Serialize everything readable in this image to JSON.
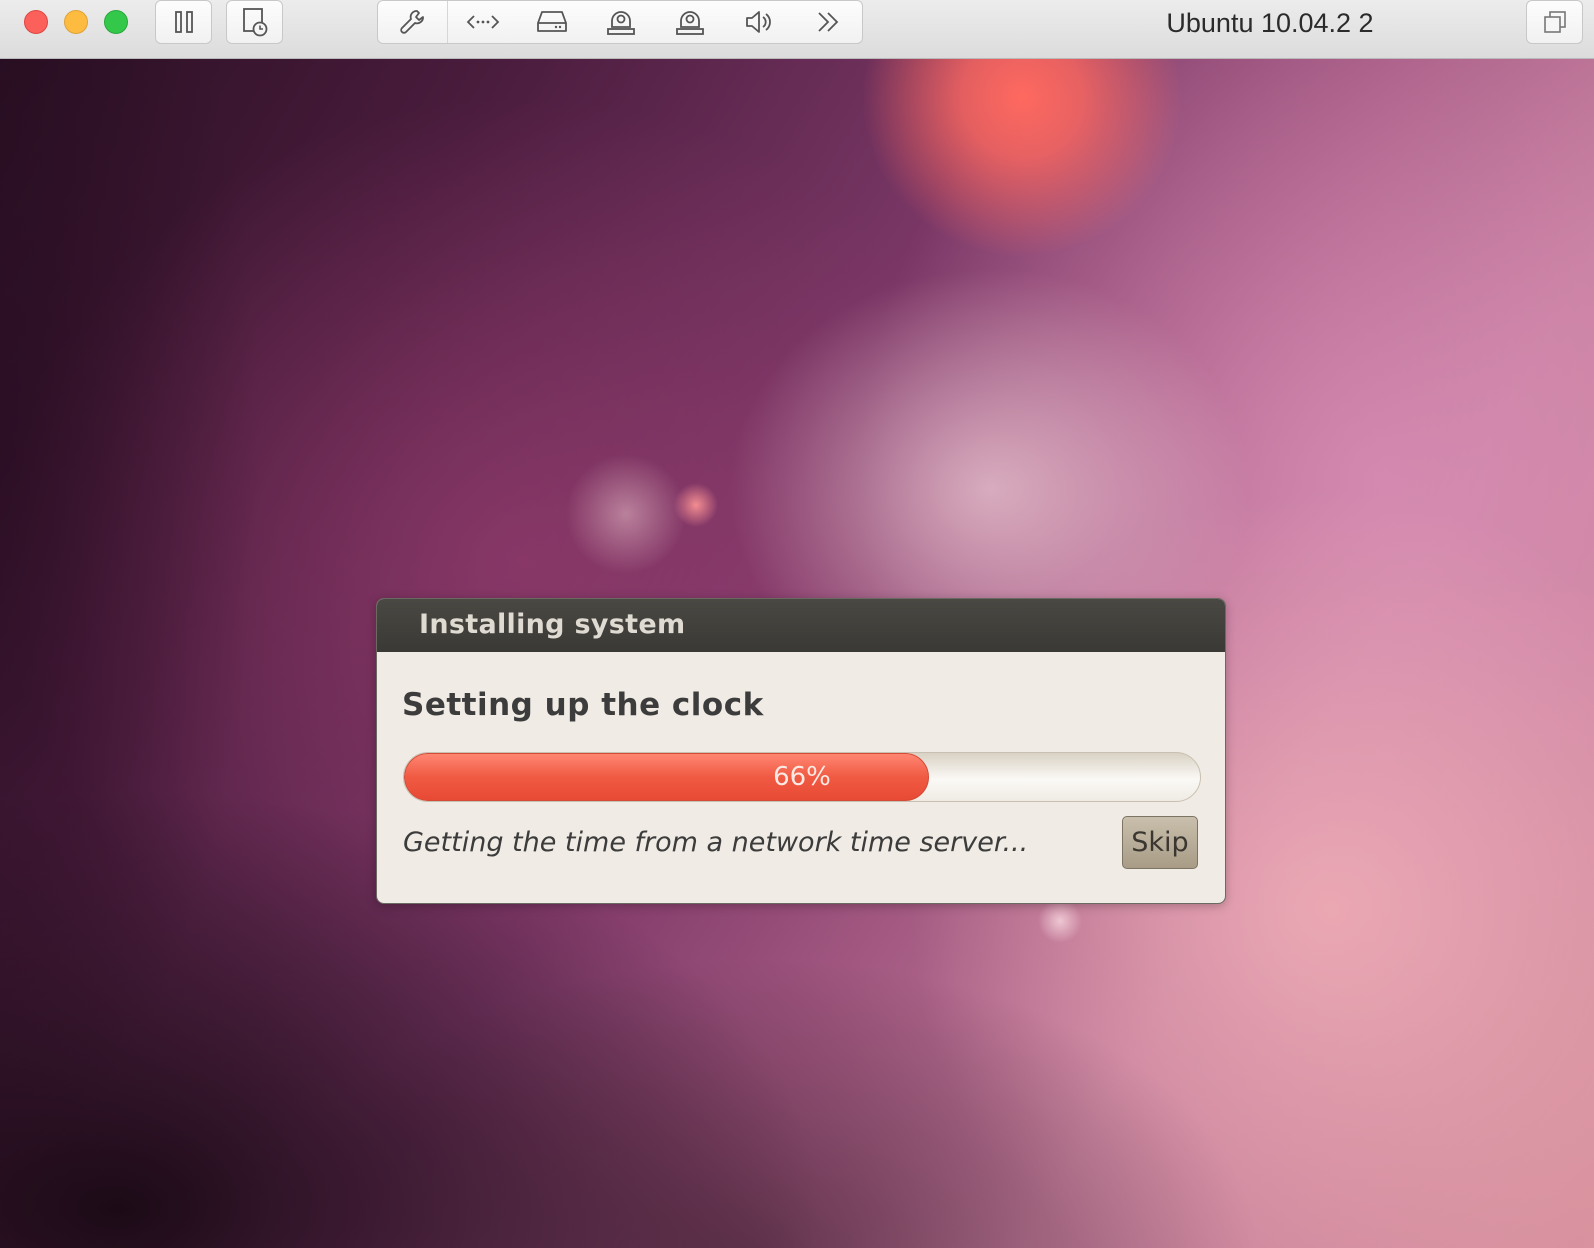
{
  "window": {
    "title": "Ubuntu 10.04.2 2",
    "toolbar": {
      "left_buttons": [
        "pause-icon",
        "snapshot-icon"
      ],
      "group": [
        "wrench-icon",
        "code-arrows-icon",
        "hard-disk-icon",
        "camera-icon",
        "webcam-icon",
        "speaker-icon",
        "chevron-double-right-icon"
      ],
      "right_button": "window-stack-icon"
    },
    "traffic_lights": {
      "close": "#fc605b",
      "minimize": "#fdbc40",
      "zoom": "#34c84a"
    }
  },
  "dialog": {
    "title": "Installing system",
    "heading": "Setting up the clock",
    "progress": {
      "value": 0.66,
      "label": "66%"
    },
    "status": "Getting the time from a network time server...",
    "skip_label": "Skip"
  },
  "colors": {
    "progress_fill": "#f05a43",
    "dialog_title_bar": "#3a3935",
    "dialog_body": "#f0ebe4",
    "skip_button": "#b3a893"
  }
}
